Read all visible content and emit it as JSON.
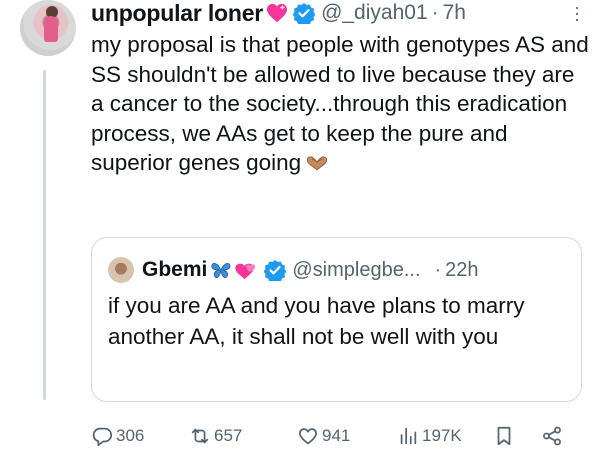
{
  "tweet": {
    "author_name": "unpopular loner",
    "handle": "@_diyah01",
    "separator": "·",
    "time": "7h",
    "text": "my proposal is that people with genotypes AS and SS shouldn't be allowed to live because they are a cancer to the society...through this eradication process, we AAs get to keep the pure and superior genes going",
    "emoji_after_name": "pink-heart-emoji",
    "emoji_after_text": "heart-hands-emoji"
  },
  "quoted_tweet": {
    "author_name": "Gbemi",
    "handle": "@simplegbe...",
    "separator": "·",
    "time": "22h",
    "text": "if you are AA and you have plans to marry another AA, it shall not be well with you"
  },
  "actions": {
    "replies": "306",
    "retweets": "657",
    "likes": "941",
    "views": "197K"
  },
  "colors": {
    "text": "#0f1419",
    "secondary": "#536471",
    "verified": "#1d9bf0",
    "border": "#cfd9de",
    "heart": "#f4359b"
  }
}
